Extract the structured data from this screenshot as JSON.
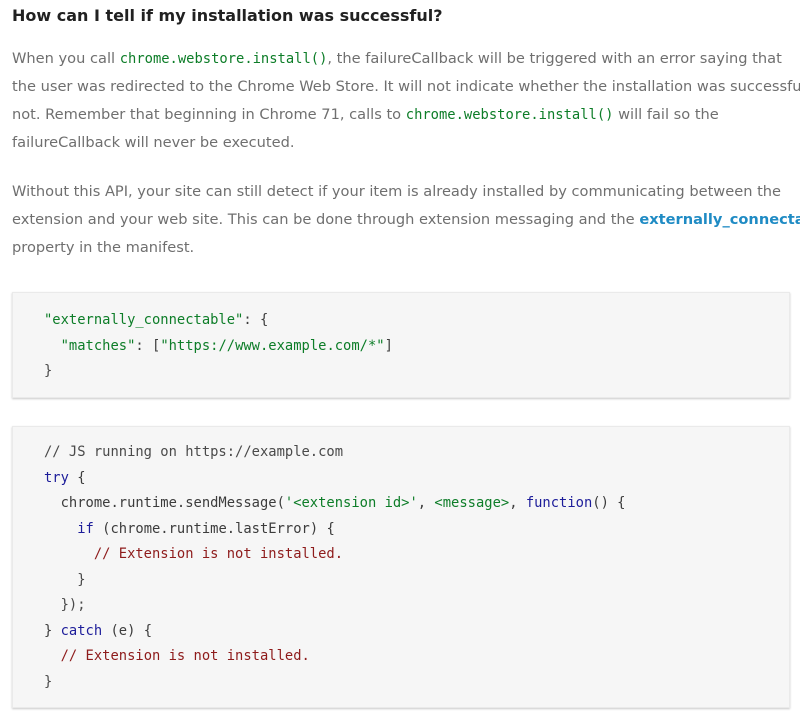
{
  "heading": "How can I tell if my installation was successful?",
  "para1": {
    "l1_a": "When you call ",
    "l1_code": "chrome.webstore.install()",
    "l1_b": ", the failureCallback will be triggered with an error saying that",
    "l2": "the user was redirected to the Chrome Web Store. It will not indicate whether the installation was successful or",
    "l3_a": "not. Remember that beginning in Chrome 71, calls to ",
    "l3_code": "chrome.webstore.install()",
    "l3_b": " will fail so the",
    "l4": "failureCallback will never be executed."
  },
  "para2": {
    "l1": "Without this API, your site can still detect if your item is already installed by communicating between the",
    "l2_a": "extension and your web site. This can be done through extension messaging and the ",
    "l2_link": "externally_connectable",
    "l3": "property in the manifest."
  },
  "code1": {
    "l1_key": "\"externally_connectable\"",
    "l1_rest": ": {",
    "l2_indent": "  ",
    "l2_key": "\"matches\"",
    "l2_mid": ": [",
    "l2_val": "\"https://www.example.com/*\"",
    "l2_end": "]",
    "l3": "}"
  },
  "code2": {
    "l1": "// JS running on https://example.com",
    "l2_kw": "try",
    "l2_rest": " {",
    "l3_a": "  chrome.runtime.sendMessage(",
    "l3_s1": "'<extension id>'",
    "l3_b": ", ",
    "l3_s2": "<message>",
    "l3_c": ", ",
    "l3_kw": "function",
    "l3_d": "() {",
    "l4_indent": "    ",
    "l4_kw": "if",
    "l4_rest": " (chrome.runtime.lastError) {",
    "l5_indent": "      ",
    "l5_cmt": "// Extension is not installed.",
    "l6": "    }",
    "l7": "  });",
    "l8_a": "} ",
    "l8_kw": "catch",
    "l8_rest": " (e) {",
    "l9_indent": "  ",
    "l9_cmt": "// Extension is not installed.",
    "l10": "}"
  }
}
